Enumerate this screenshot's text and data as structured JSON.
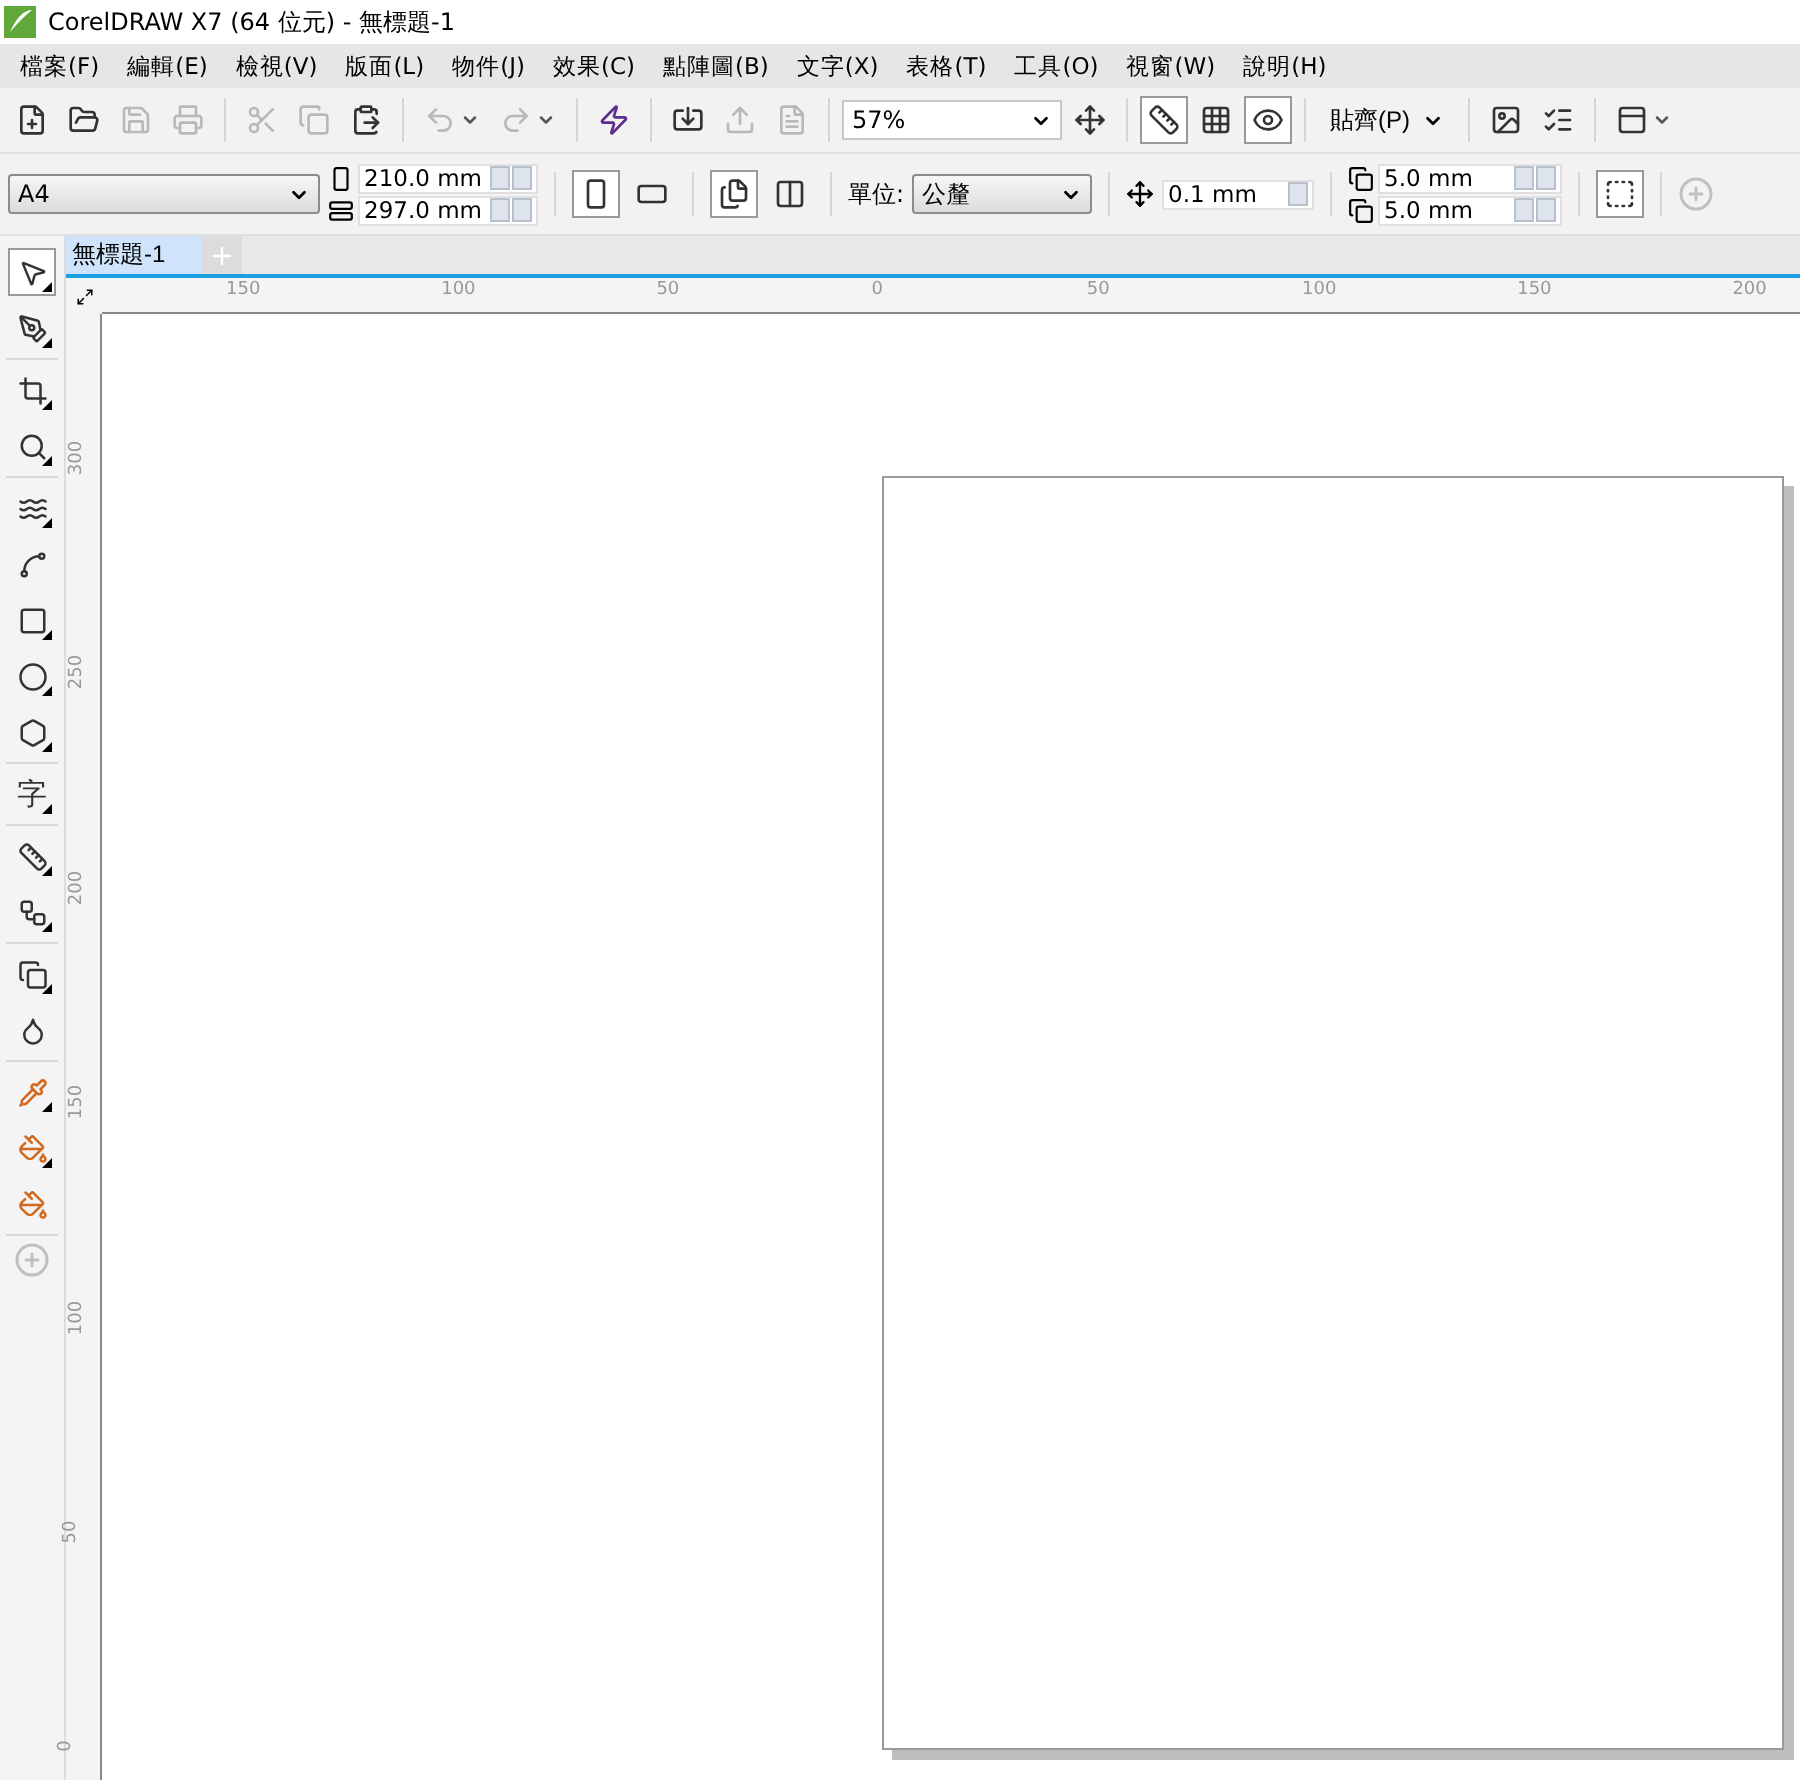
{
  "window": {
    "title": "CorelDRAW X7 (64 位元) - 無標題-1"
  },
  "menu": [
    "檔案(F)",
    "編輯(E)",
    "檢視(V)",
    "版面(L)",
    "物件(J)",
    "效果(C)",
    "點陣圖(B)",
    "文字(X)",
    "表格(T)",
    "工具(O)",
    "視窗(W)",
    "說明(H)"
  ],
  "toolbar": [
    {
      "kind": "button",
      "disabled": false,
      "pressed": false
    },
    {
      "kind": "button",
      "disabled": false,
      "pressed": false
    },
    {
      "kind": "button",
      "disabled": true,
      "pressed": false
    },
    {
      "kind": "button",
      "disabled": true,
      "pressed": false
    },
    {
      "kind": "separator"
    },
    {
      "kind": "button",
      "disabled": true,
      "pressed": false
    },
    {
      "kind": "button",
      "disabled": true,
      "pressed": false
    },
    {
      "kind": "button",
      "disabled": false,
      "pressed": false
    },
    {
      "kind": "separator"
    },
    {
      "kind": "button",
      "disabled": true,
      "pressed": false,
      "caret": true
    },
    {
      "kind": "button",
      "disabled": true,
      "pressed": false,
      "caret": true
    },
    {
      "kind": "separator"
    },
    {
      "kind": "button",
      "disabled": false,
      "pressed": false
    },
    {
      "kind": "separator"
    },
    {
      "kind": "button",
      "disabled": false,
      "pressed": false
    },
    {
      "kind": "button",
      "disabled": true,
      "pressed": false
    },
    {
      "kind": "button",
      "disabled": true,
      "pressed": false
    },
    {
      "kind": "separator"
    },
    {
      "kind": "combo",
      "value": "57%"
    },
    {
      "kind": "button",
      "disabled": false,
      "pressed": false
    },
    {
      "kind": "separator"
    },
    {
      "kind": "button",
      "disabled": false,
      "pressed": true
    },
    {
      "kind": "button",
      "disabled": false,
      "pressed": false
    },
    {
      "kind": "button",
      "disabled": false,
      "pressed": true
    },
    {
      "kind": "separator"
    },
    {
      "kind": "menu",
      "label": "貼齊(P)"
    },
    {
      "kind": "separator"
    },
    {
      "kind": "button",
      "disabled": false,
      "pressed": false
    },
    {
      "kind": "button",
      "disabled": false,
      "pressed": false
    },
    {
      "kind": "separator"
    },
    {
      "kind": "button",
      "disabled": false,
      "pressed": false,
      "caret": true
    }
  ],
  "property_bar": {
    "page_size": "A4",
    "width": "210.0 mm",
    "height": "297.0 mm",
    "orientation": [
      {
        "selected": true
      },
      {
        "selected": false
      }
    ],
    "page_scope": [
      {
        "selected": true
      },
      {
        "selected": false
      }
    ],
    "units_label": "單位:",
    "units": "公釐",
    "nudge": "0.1 mm",
    "duplicate_x": "5.0 mm",
    "duplicate_y": "5.0 mm"
  },
  "tabs": [
    {
      "label": "無標題-1",
      "selected": true
    }
  ],
  "tool_groups": [
    {
      "tools": [
        {
          "selected": true,
          "flyout": true
        },
        {
          "selected": false,
          "flyout": true
        }
      ]
    },
    {
      "tools": [
        {
          "selected": false,
          "flyout": true
        },
        {
          "selected": false,
          "flyout": true
        }
      ]
    },
    {
      "tools": [
        {
          "selected": false,
          "flyout": true
        },
        {
          "selected": false,
          "flyout": false
        },
        {
          "selected": false,
          "flyout": true
        },
        {
          "selected": false,
          "flyout": true
        },
        {
          "selected": false,
          "flyout": true
        }
      ]
    },
    {
      "tools": [
        {
          "selected": false,
          "flyout": true,
          "glyph": "字"
        }
      ]
    },
    {
      "tools": [
        {
          "selected": false,
          "flyout": true
        },
        {
          "selected": false,
          "flyout": true
        }
      ]
    },
    {
      "tools": [
        {
          "selected": false,
          "flyout": true
        },
        {
          "selected": false,
          "flyout": false
        }
      ]
    },
    {
      "tools": [
        {
          "selected": false,
          "flyout": true
        },
        {
          "selected": false,
          "flyout": true
        },
        {
          "selected": false,
          "flyout": false
        }
      ]
    }
  ],
  "rulers": {
    "horizontal": [
      "150",
      "100",
      "50",
      "0",
      "50",
      "100",
      "150",
      "200"
    ],
    "vertical": [
      "300",
      "250",
      "200",
      "150",
      "100",
      "50",
      "0"
    ]
  }
}
